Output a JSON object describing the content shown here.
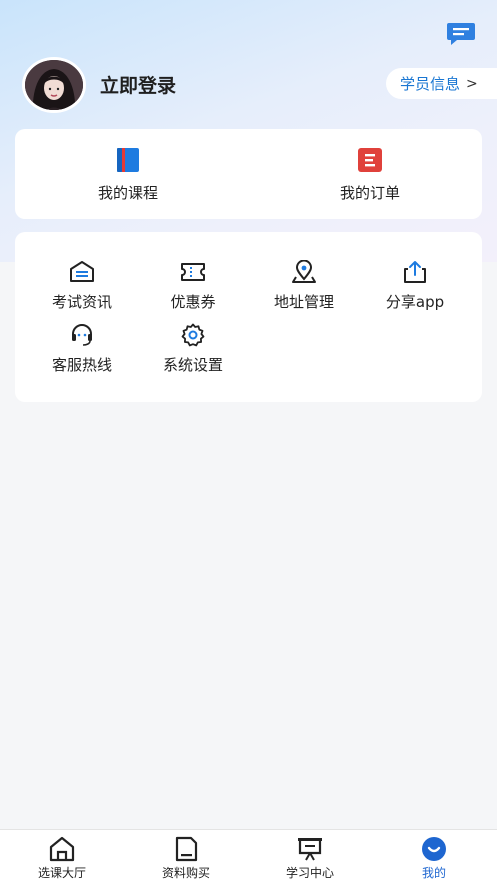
{
  "header": {
    "login_label": "立即登录",
    "student_info_label": "学员信息",
    "message_icon": "message-icon"
  },
  "quick_cards": [
    {
      "label": "我的课程",
      "icon": "book-icon",
      "color": "#1e7be0"
    },
    {
      "label": "我的订单",
      "icon": "order-icon",
      "color": "#e0413b"
    }
  ],
  "services": [
    {
      "label": "考试资讯",
      "icon": "exam-news-icon"
    },
    {
      "label": "优惠券",
      "icon": "coupon-icon"
    },
    {
      "label": "地址管理",
      "icon": "location-icon"
    },
    {
      "label": "分享app",
      "icon": "share-icon"
    },
    {
      "label": "客服热线",
      "icon": "headset-icon"
    },
    {
      "label": "系统设置",
      "icon": "settings-icon"
    }
  ],
  "tabbar": {
    "items": [
      {
        "label": "选课大厅",
        "icon": "home-icon",
        "active": false
      },
      {
        "label": "资料购买",
        "icon": "document-icon",
        "active": false
      },
      {
        "label": "学习中心",
        "icon": "presentation-icon",
        "active": false
      },
      {
        "label": "我的",
        "icon": "profile-icon",
        "active": true
      }
    ],
    "active_color": "#1e66d0"
  }
}
